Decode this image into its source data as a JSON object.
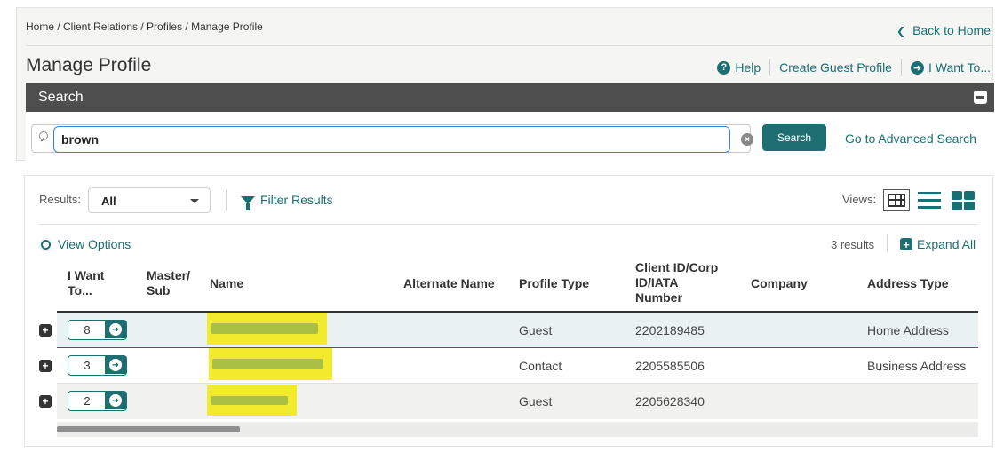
{
  "breadcrumb": "Home / Client Relations / Profiles / Manage Profile",
  "back_to_home": "Back to Home",
  "page_title": "Manage Profile",
  "top_links": {
    "help": "Help",
    "create_guest_profile": "Create Guest Profile",
    "i_want_to": "I Want To..."
  },
  "search": {
    "title": "Search",
    "query": "brown",
    "button": "Search",
    "advanced": "Go to Advanced Search"
  },
  "results_bar": {
    "label": "Results:",
    "selected": "All",
    "filter": "Filter Results",
    "views_label": "Views:"
  },
  "view_options": "View Options",
  "results_count": "3 results",
  "expand_all": "Expand All",
  "columns": {
    "i_want_to": "I Want To...",
    "master_sub": "Master/ Sub",
    "name": "Name",
    "alternate_name": "Alternate Name",
    "profile_type": "Profile Type",
    "client_id": "Client ID/Corp ID/IATA Number",
    "company": "Company",
    "address_type": "Address Type"
  },
  "rows": [
    {
      "count": "8",
      "profile_type": "Guest",
      "client_id": "2202189485",
      "address_type": "Home Address"
    },
    {
      "count": "3",
      "profile_type": "Contact",
      "client_id": "2205585506",
      "address_type": "Business Address"
    },
    {
      "count": "2",
      "profile_type": "Guest",
      "client_id": "2205628340",
      "address_type": ""
    }
  ],
  "colors": {
    "accent": "#1a6f73",
    "header_bar": "#4e4e4e",
    "highlight": "#f2ea2c",
    "selected_row": "#eaf2f3"
  }
}
